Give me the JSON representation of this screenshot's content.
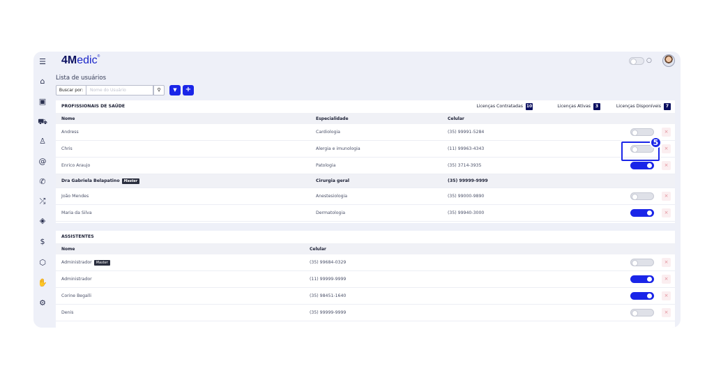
{
  "app": {
    "logo_bold": "4M",
    "logo_rest": "edic",
    "logo_tm": "®"
  },
  "sidebar": {
    "icons": [
      "menu-icon",
      "home-icon",
      "calendar-icon",
      "car-icon",
      "user-icon",
      "at-icon",
      "phone-icon",
      "shuffle-icon",
      "tag-icon",
      "dollar-icon",
      "box-icon",
      "hand-icon",
      "gear-icon"
    ]
  },
  "header": {
    "toggle_state": "off",
    "chat_icon": "chat-icon",
    "avatar_icon": "avatar"
  },
  "page": {
    "title": "Lista de usuários"
  },
  "search": {
    "label": "Buscar por:",
    "placeholder": "Nome do Usuário",
    "search_icon": "search-icon",
    "filter_icon": "filter-icon",
    "add_icon": "plus-icon"
  },
  "professionals": {
    "title": "PROFISSIONAIS DE SAÚDE",
    "licenses": [
      {
        "label": "Licenças Contratadas",
        "count": "10"
      },
      {
        "label": "Licenças Ativas",
        "count": "3"
      },
      {
        "label": "Licenças Disponíveis",
        "count": "7"
      }
    ],
    "columns": [
      "Nome",
      "Especialidade",
      "Celular"
    ],
    "rows": [
      {
        "name": "Andress",
        "specialty": "Cardiologia",
        "phone": "(35) 99991-5284",
        "active": false
      },
      {
        "name": "Chris",
        "specialty": "Alergia e imunologia",
        "phone": "(11) 99963-4343",
        "active": false
      },
      {
        "name": "Enrico Araujo",
        "specialty": "Patologia",
        "phone": "(35) 3714-3935",
        "active": true
      },
      {
        "name": "Dra Gabriela Belapatino",
        "badge": "Master",
        "specialty": "Cirurgia geral",
        "phone": "(35) 99999-9999",
        "master": true
      },
      {
        "name": "João Mendes",
        "specialty": "Anestesiologia",
        "phone": "(35) 99000-9890",
        "active": false
      },
      {
        "name": "Maria da Silva",
        "specialty": "Dermatologia",
        "phone": "(35) 99940-3000",
        "active": true
      }
    ]
  },
  "assistants": {
    "title": "ASSISTENTES",
    "columns": [
      "Nome",
      "Celular"
    ],
    "rows": [
      {
        "name": "Administrador",
        "badge": "Master",
        "phone": "(35) 99684-0329",
        "active": false
      },
      {
        "name": "Administrador",
        "phone": "(11) 99999-9999",
        "active": true
      },
      {
        "name": "Corine Begalli",
        "phone": "(35) 98451-1640",
        "active": true
      },
      {
        "name": "Denis",
        "phone": "(35) 99999-9999",
        "active": false
      }
    ]
  },
  "delete_symbol": "×",
  "step_marker": "5",
  "colors": {
    "accent": "#1a25e8",
    "brand_dark": "#0b1060",
    "background": "#eef0f8",
    "delete": "#e08a95"
  }
}
